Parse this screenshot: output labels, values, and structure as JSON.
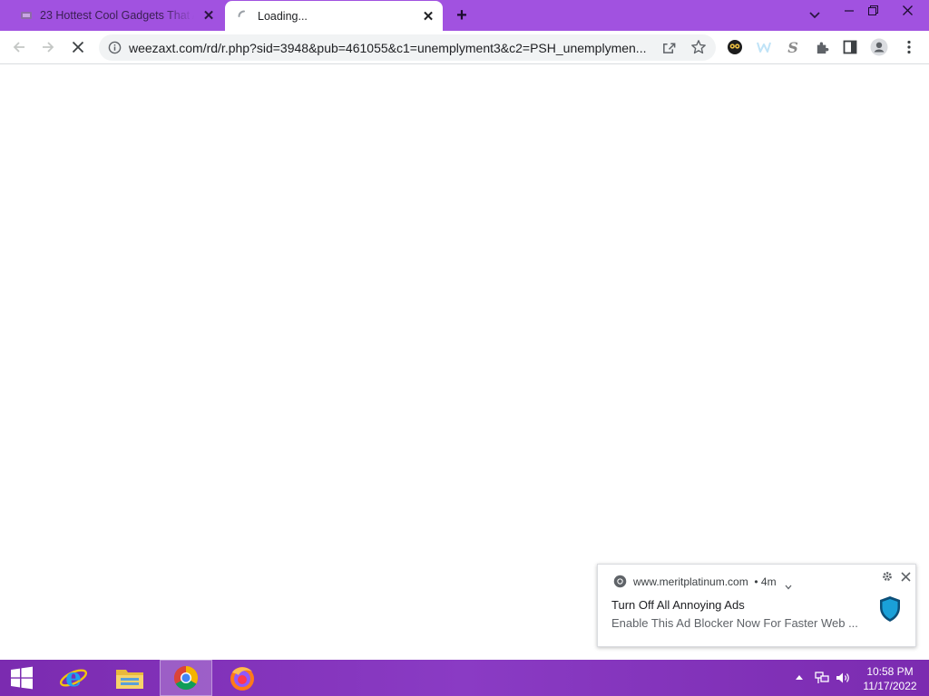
{
  "tabs": [
    {
      "title": "23 Hottest Cool Gadgets That Ar",
      "active": false
    },
    {
      "title": "Loading...",
      "active": true
    }
  ],
  "address_bar": {
    "url": "weezaxt.com/rd/r.php?sid=3948&pub=461055&c1=unemplyment3&c2=PSH_unemplymen..."
  },
  "icons": {
    "back": "arrow-left-icon",
    "forward": "arrow-right-icon",
    "stop": "close-x-icon",
    "site_info": "info-icon",
    "share": "share-icon",
    "bookmark": "star-icon",
    "extensions": "puzzle-icon",
    "side_panel": "side-panel-icon",
    "profile": "person-icon",
    "menu": "kebab-menu-icon"
  },
  "notification": {
    "source": "www.meritplatinum.com",
    "age": "• 4m",
    "title": "Turn Off All Annoying Ads",
    "body": "Enable This Ad Blocker Now For Faster Web ..."
  },
  "taskbar": {
    "time": "10:58 PM",
    "date": "11/17/2022"
  },
  "colors": {
    "chrome_frame": "#a152e0",
    "taskbar": "#7b2bb0",
    "shield": "#1aa0d8"
  }
}
